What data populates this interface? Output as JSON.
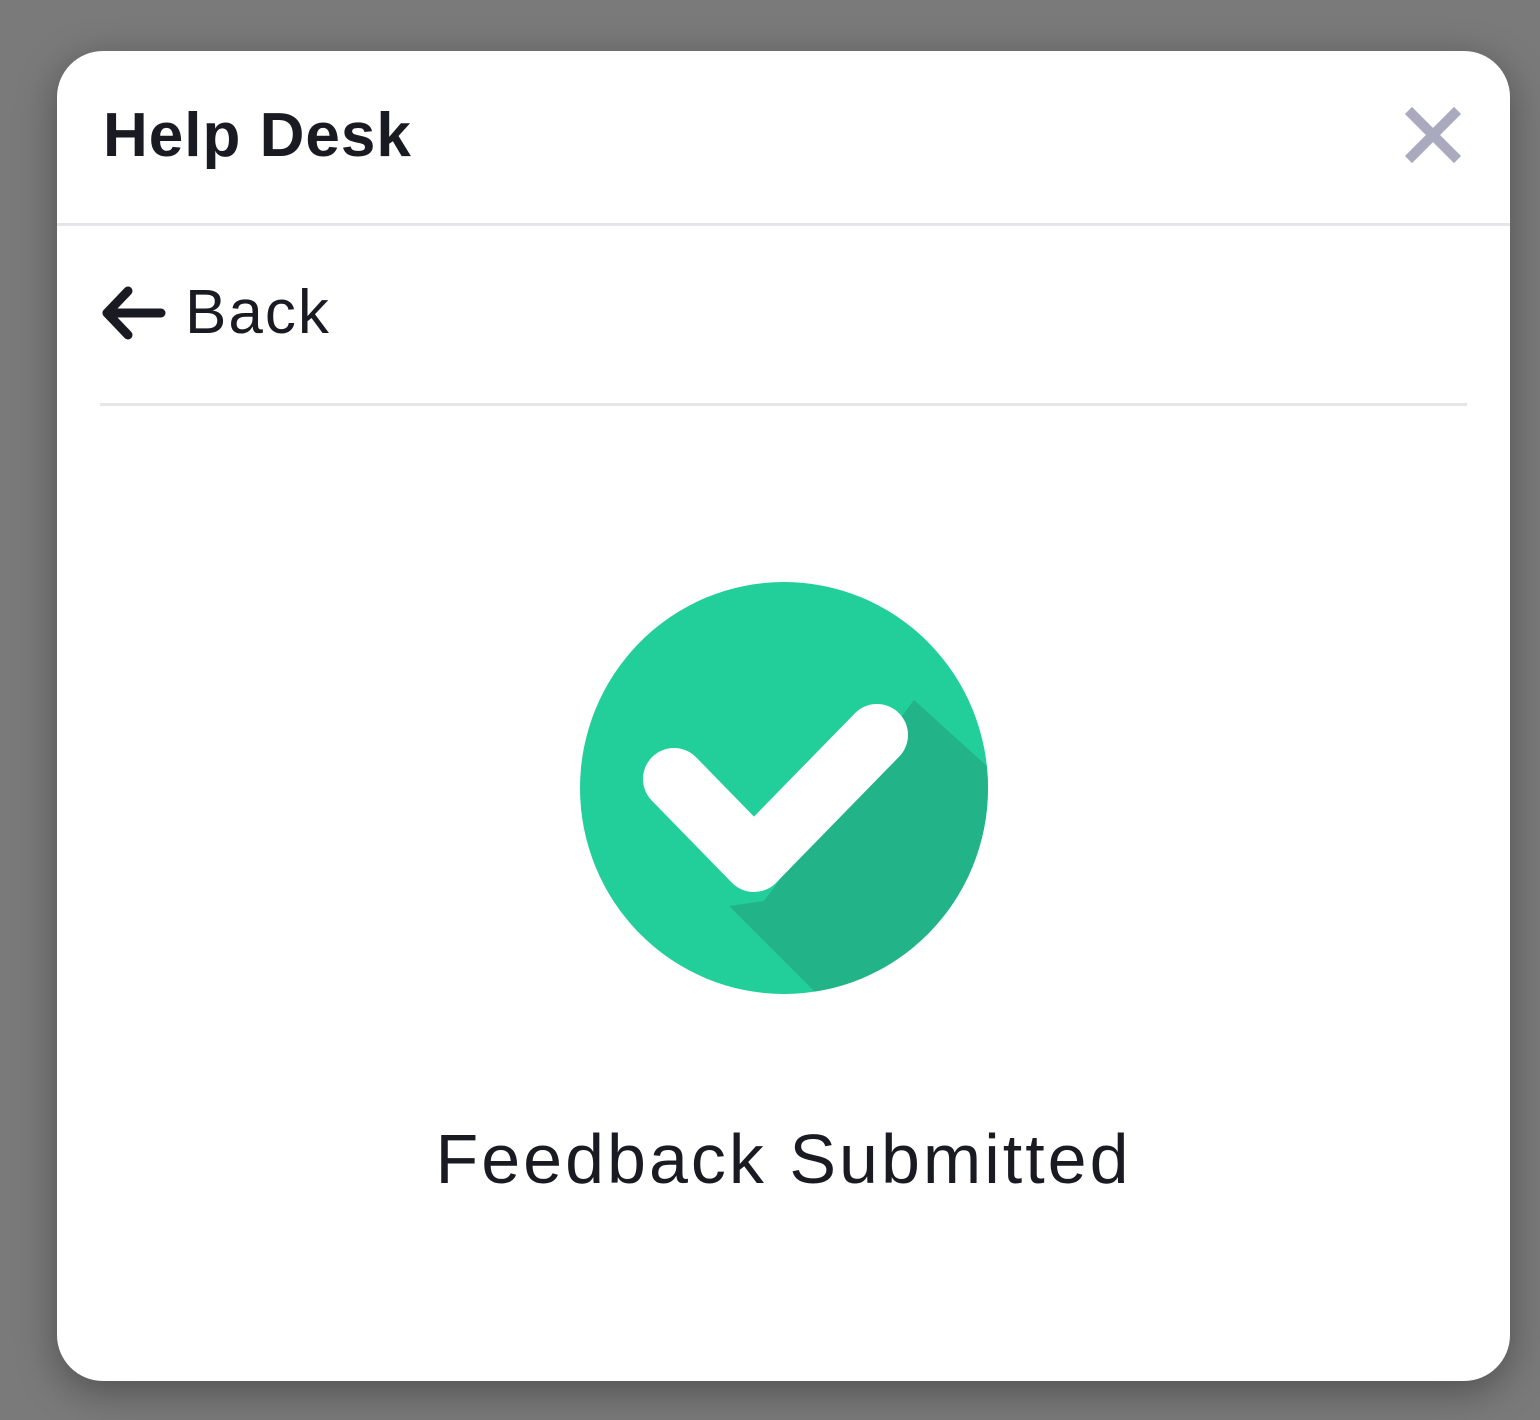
{
  "modal": {
    "title": "Help Desk",
    "close_icon": "close-icon",
    "back_label": "Back",
    "back_icon": "arrow-left-icon",
    "success_icon": "check-circle-icon",
    "status_text": "Feedback Submitted"
  },
  "colors": {
    "backdrop": "#7a7a7a",
    "modal_background": "#ffffff",
    "text": "#1a1b22",
    "close_icon": "#a9aabd",
    "success_green": "#22cf9b",
    "success_shadow": "#22b488",
    "divider": "#e6e6ea"
  }
}
